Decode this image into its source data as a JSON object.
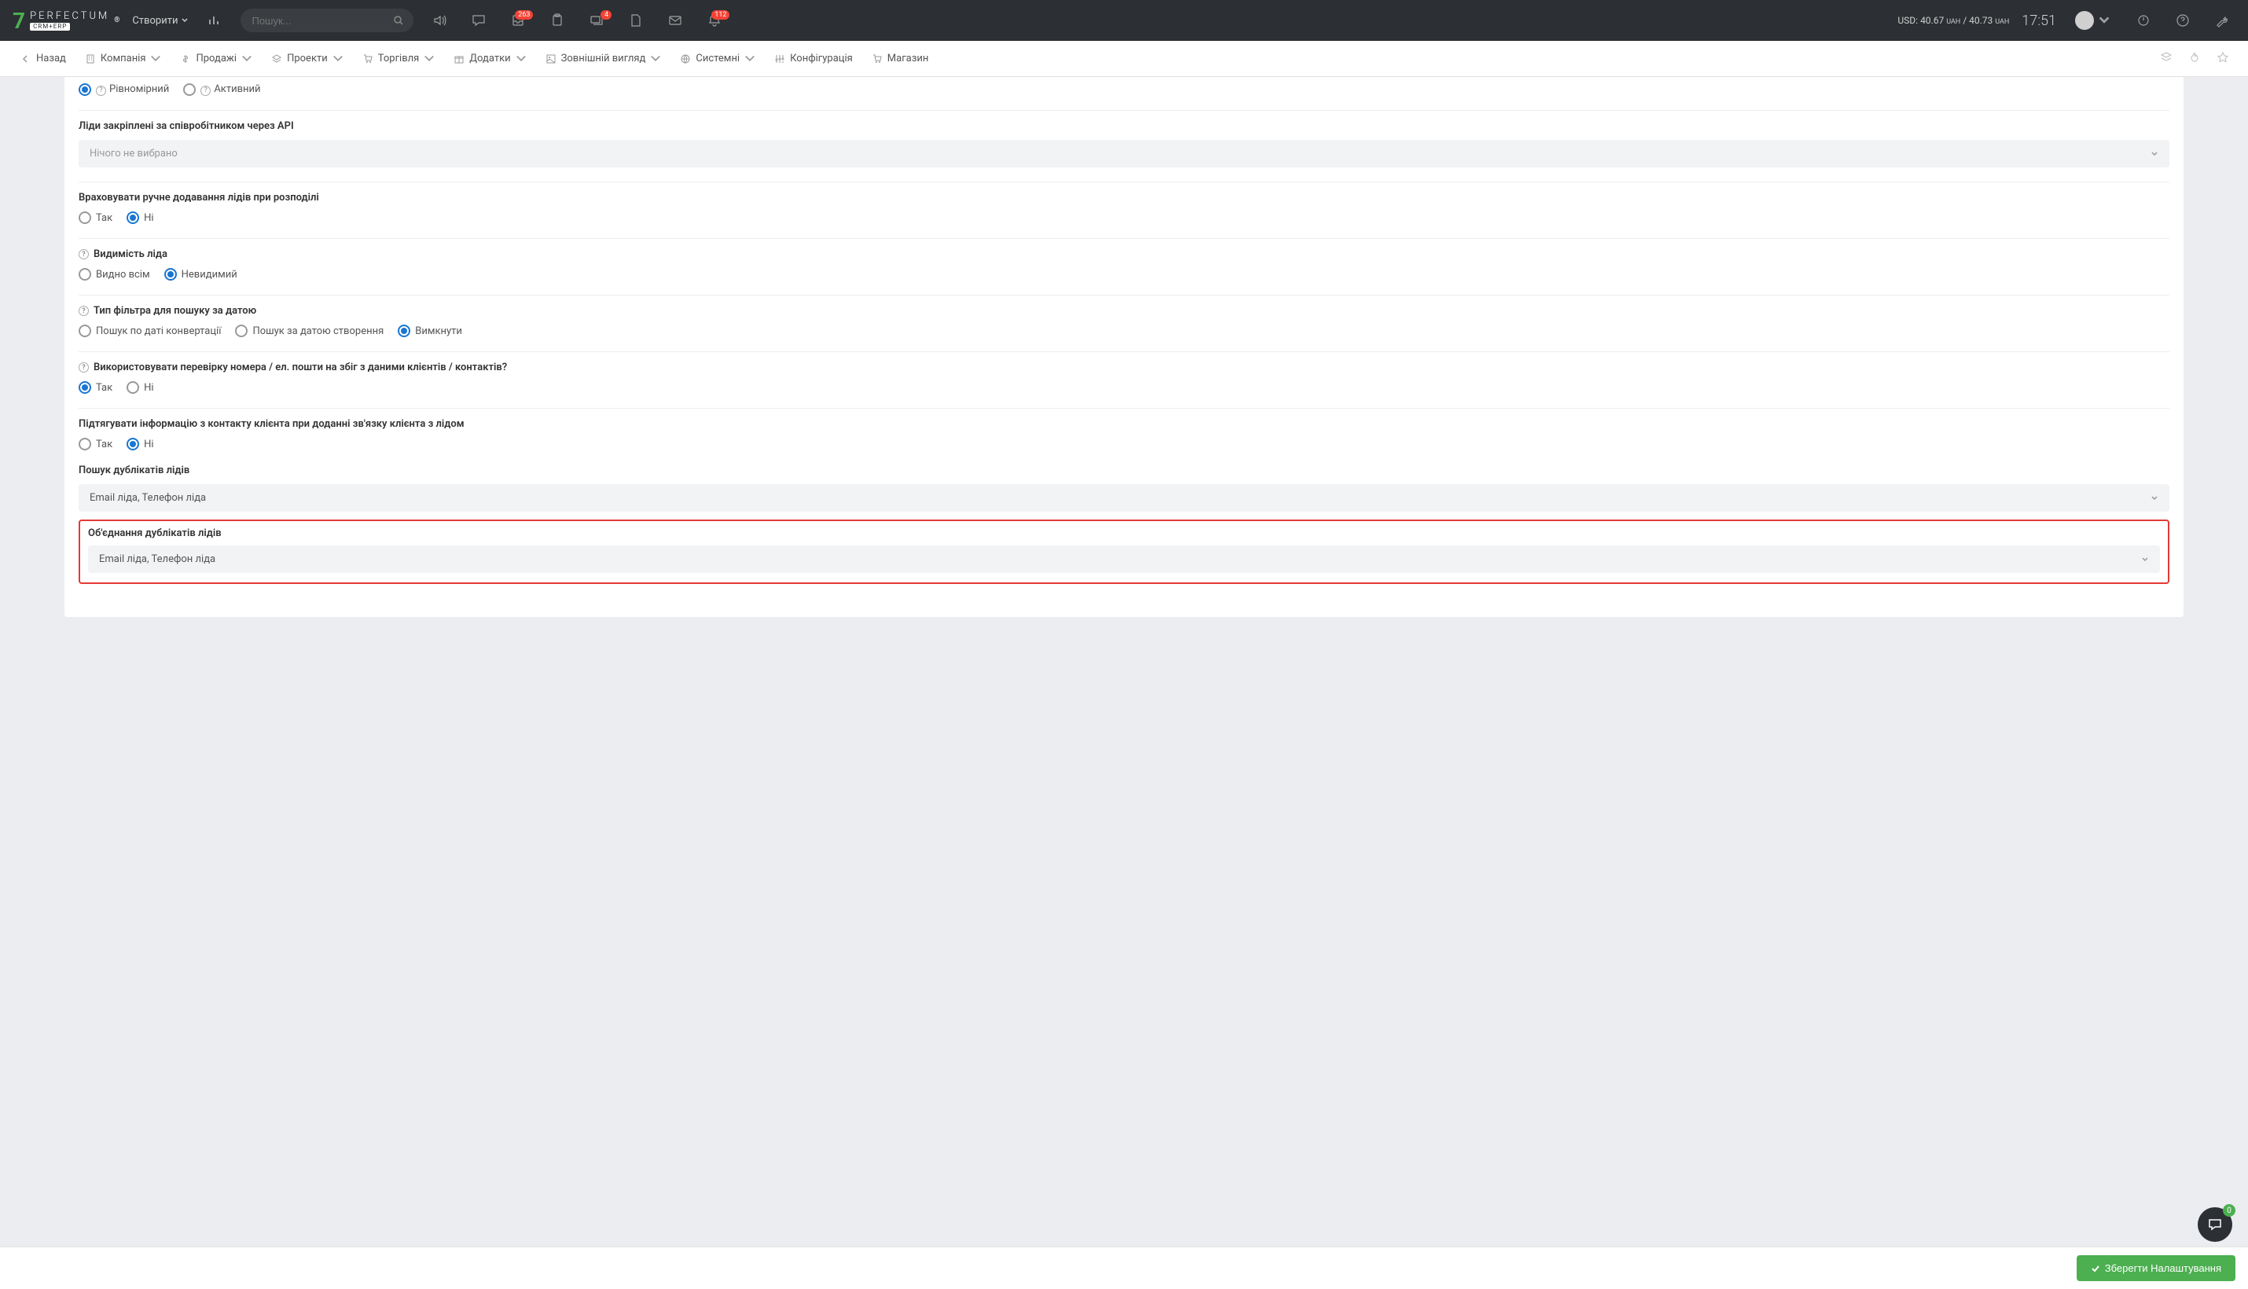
{
  "header": {
    "logo_main": "PERFECTUM",
    "logo_sub": "CRM+ERP",
    "create_label": "Створити",
    "search_placeholder": "Пошук...",
    "badges": {
      "inbox": "263",
      "chat": "4",
      "bell": "112"
    },
    "currency_prefix": "USD: ",
    "currency_val1": "40.67",
    "currency_val2": "40.73",
    "currency_unit": "UAH",
    "currency_sep": " / ",
    "time": "17:51"
  },
  "nav": {
    "back": "Назад",
    "company": "Компанія",
    "sales": "Продажі",
    "projects": "Проекти",
    "trade": "Торгівля",
    "addons": "Додатки",
    "appearance": "Зовнішній вигляд",
    "system": "Системні",
    "config": "Конфігурація",
    "shop": "Магазин"
  },
  "form": {
    "section0": {
      "opt1": "Рівномірний",
      "opt2": "Активний"
    },
    "section1": {
      "label": "Ліди закріплені за співробітником через API",
      "value": "Нічого не вибрано"
    },
    "section2": {
      "label": "Враховувати ручне додавання лідів при розподілі",
      "yes": "Так",
      "no": "Ні"
    },
    "section3": {
      "label": "Видимість ліда",
      "opt1": "Видно всім",
      "opt2": "Невидимий"
    },
    "section4": {
      "label": "Тип фільтра для пошуку за датою",
      "opt1": "Пошук по даті конвертації",
      "opt2": "Пошук за датою створення",
      "opt3": "Вимкнути"
    },
    "section5": {
      "label": "Використовувати перевірку номера / ел. пошти на збіг з даними клієнтів / контактів?",
      "yes": "Так",
      "no": "Ні"
    },
    "section6": {
      "label": "Підтягувати інформацію з контакту клієнта при доданні зв'язку клієнта з лідом",
      "yes": "Так",
      "no": "Ні"
    },
    "section7": {
      "label": "Пошук дублікатів лідів",
      "value": "Email ліда, Телефон ліда"
    },
    "section8": {
      "label": "Об'єднання дублікатів лідів",
      "value": "Email ліда, Телефон ліда"
    }
  },
  "save_label": "Зберегти Налаштування",
  "chat_badge": "0"
}
